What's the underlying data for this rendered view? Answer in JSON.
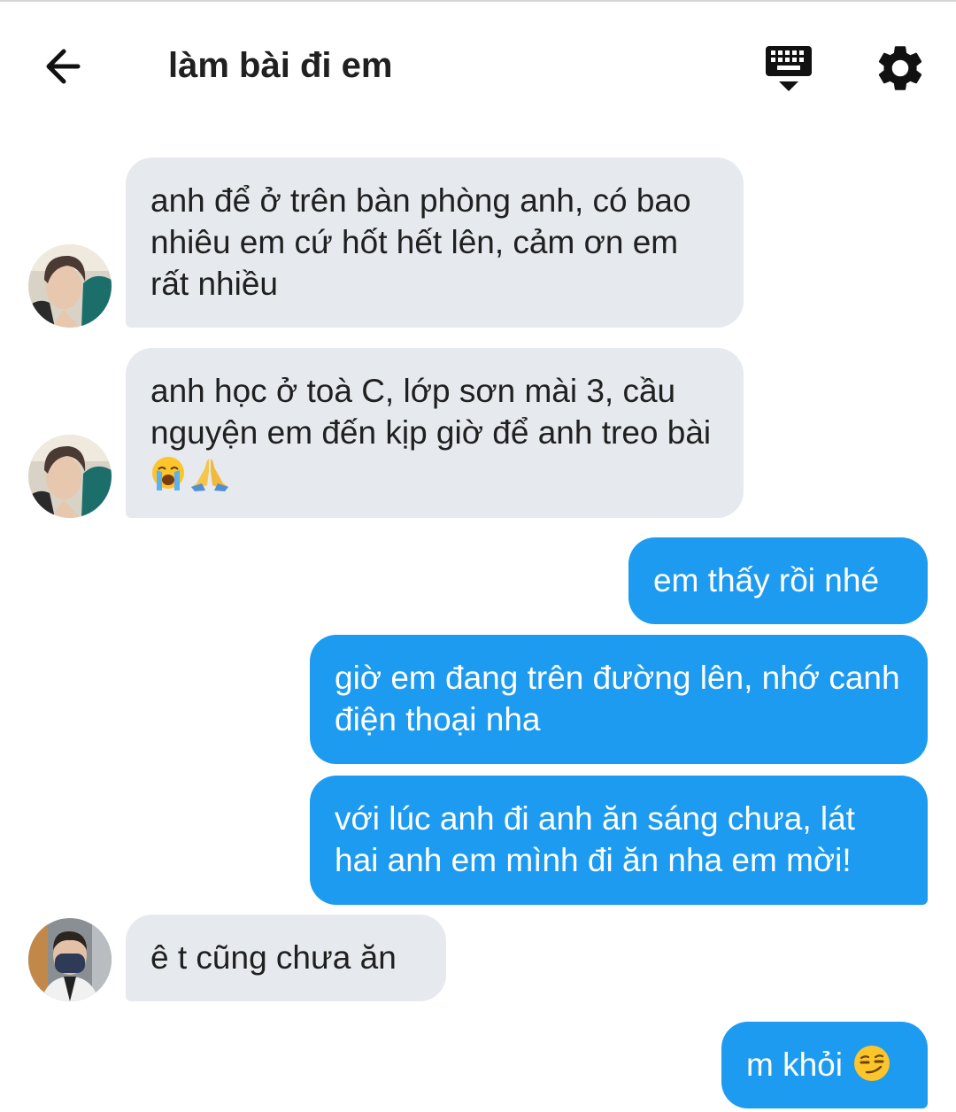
{
  "header": {
    "title": "làm bài đi em",
    "back_icon": "arrow-left-icon",
    "keyboard_icon": "keyboard-hide-icon",
    "settings_icon": "gear-icon"
  },
  "colors": {
    "incoming_bubble": "#e6e9ee",
    "outgoing_bubble": "#1d9bf0",
    "outgoing_text": "#ffffff",
    "header_icon": "#111111"
  },
  "messages": [
    {
      "direction": "incoming",
      "text": "anh để ở trên bàn phòng anh, có bao nhiêu em cứ hốt hết lên, cảm ơn em rất nhiều"
    },
    {
      "direction": "incoming",
      "text": "anh học ở toà C, lớp sơn mài 3, cầu nguyện em đến kịp giờ để anh treo bài",
      "emojis": [
        "loudly-crying-face-emoji",
        "folded-hands-emoji"
      ]
    },
    {
      "direction": "outgoing",
      "text": "em thấy rồi nhé"
    },
    {
      "direction": "outgoing",
      "text": "giờ em đang trên đường lên, nhớ canh điện thoại nha"
    },
    {
      "direction": "outgoing",
      "text": "với lúc anh đi anh ăn sáng chưa, lát hai anh em mình đi ăn nha em mời!"
    },
    {
      "direction": "incoming",
      "text": "ê t cũng chưa ăn"
    },
    {
      "direction": "outgoing",
      "text": "m khỏi",
      "emojis": [
        "smirking-face-emoji"
      ]
    }
  ]
}
